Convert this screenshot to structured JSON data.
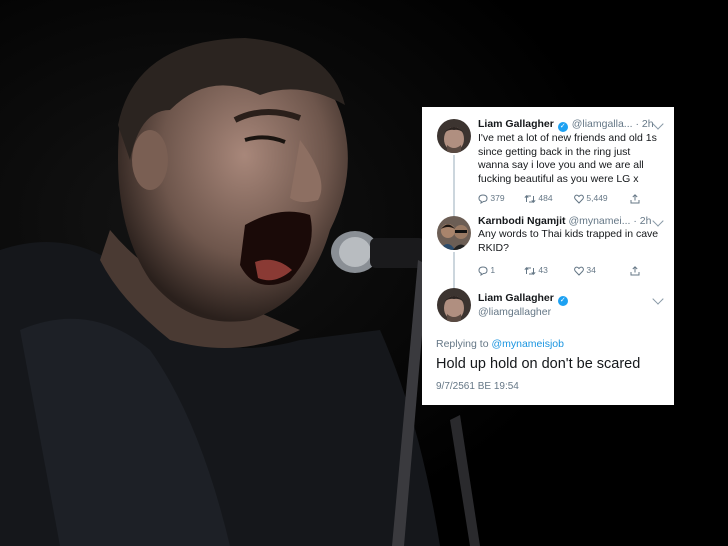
{
  "tweets": [
    {
      "name": "Liam Gallagher",
      "handle": "@liamgalla...",
      "time": "· 2h",
      "text": "I've met a lot of new friends and old 1s since getting back in the ring just wanna say i love you and we are all fucking beautiful as you were LG x",
      "replies": "379",
      "retweets": "484",
      "likes": "5,449"
    },
    {
      "name": "Karnbodi Ngamjit",
      "handle": "@mynamei...",
      "time": "· 2h",
      "text": "Any words to Thai kids trapped in cave RKID?",
      "replies": "1",
      "retweets": "43",
      "likes": "34"
    }
  ],
  "main_tweet": {
    "name": "Liam Gallagher",
    "handle": "@liamgallagher",
    "replying_prefix": "Replying to",
    "replying_to": "@mynameisjob",
    "text": "Hold up hold on don't be scared",
    "date": "9/7/2561 BE 19:54"
  },
  "colors": {
    "accent": "#1da1f2",
    "muted": "#657786",
    "text": "#14171a"
  },
  "icons": [
    "reply-icon",
    "retweet-icon",
    "like-icon",
    "share-icon",
    "verified-icon",
    "chevron-down-icon"
  ]
}
